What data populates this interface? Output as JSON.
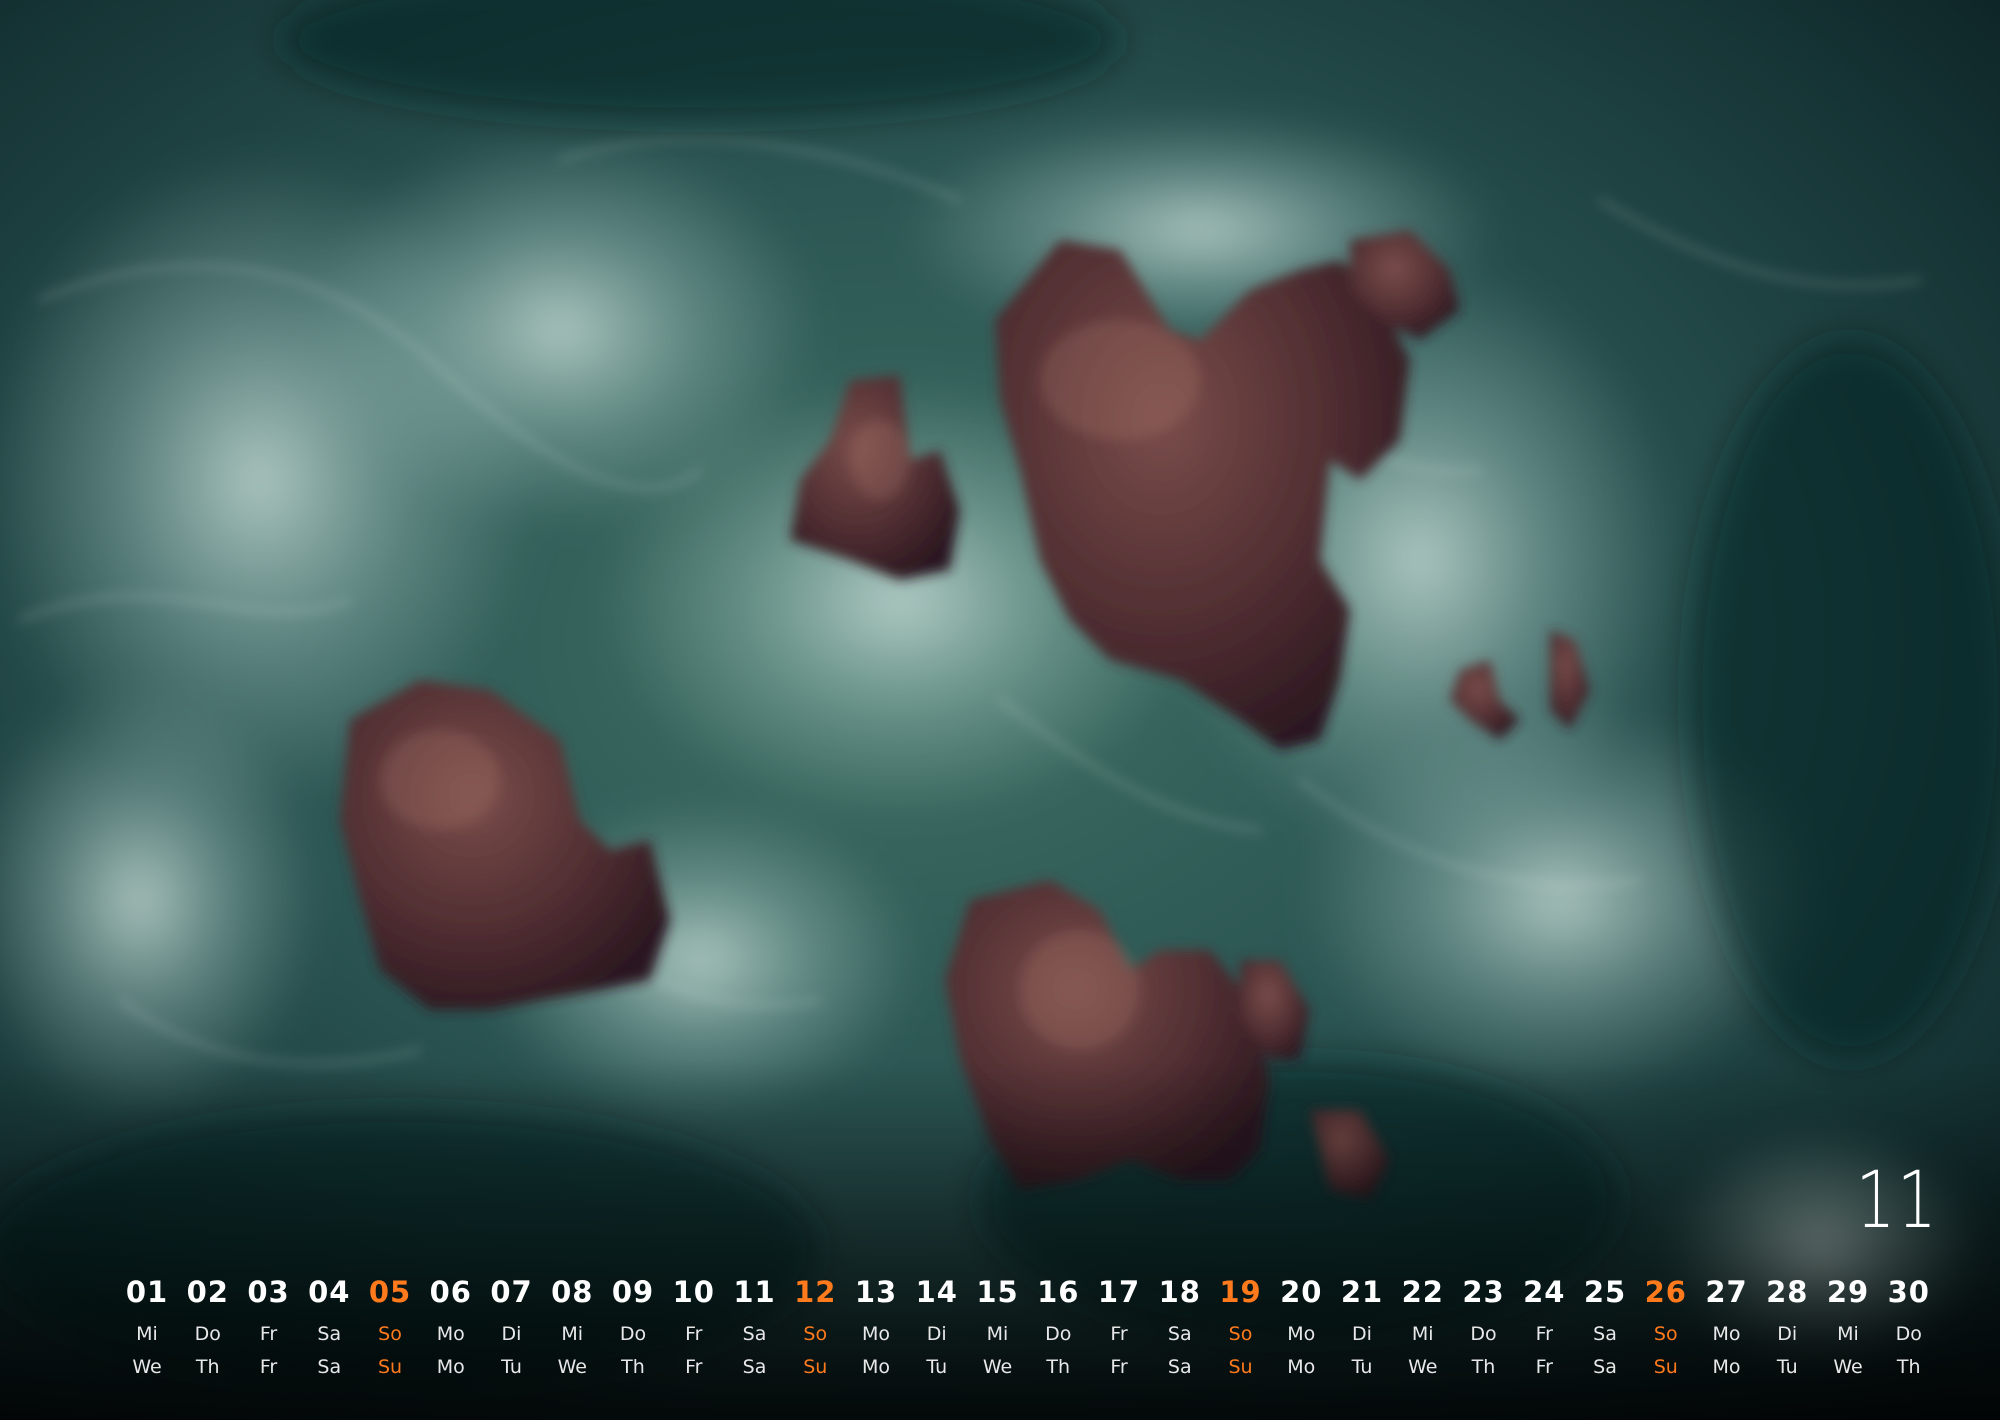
{
  "month": "11",
  "colors": {
    "sunday": "#ff7a1c",
    "text": "#ffffff"
  },
  "days": [
    {
      "num": "01",
      "de": "Mi",
      "en": "We",
      "sunday": false
    },
    {
      "num": "02",
      "de": "Do",
      "en": "Th",
      "sunday": false
    },
    {
      "num": "03",
      "de": "Fr",
      "en": "Fr",
      "sunday": false
    },
    {
      "num": "04",
      "de": "Sa",
      "en": "Sa",
      "sunday": false
    },
    {
      "num": "05",
      "de": "So",
      "en": "Su",
      "sunday": true
    },
    {
      "num": "06",
      "de": "Mo",
      "en": "Mo",
      "sunday": false
    },
    {
      "num": "07",
      "de": "Di",
      "en": "Tu",
      "sunday": false
    },
    {
      "num": "08",
      "de": "Mi",
      "en": "We",
      "sunday": false
    },
    {
      "num": "09",
      "de": "Do",
      "en": "Th",
      "sunday": false
    },
    {
      "num": "10",
      "de": "Fr",
      "en": "Fr",
      "sunday": false
    },
    {
      "num": "11",
      "de": "Sa",
      "en": "Sa",
      "sunday": false
    },
    {
      "num": "12",
      "de": "So",
      "en": "Su",
      "sunday": true
    },
    {
      "num": "13",
      "de": "Mo",
      "en": "Mo",
      "sunday": false
    },
    {
      "num": "14",
      "de": "Di",
      "en": "Tu",
      "sunday": false
    },
    {
      "num": "15",
      "de": "Mi",
      "en": "We",
      "sunday": false
    },
    {
      "num": "16",
      "de": "Do",
      "en": "Th",
      "sunday": false
    },
    {
      "num": "17",
      "de": "Fr",
      "en": "Fr",
      "sunday": false
    },
    {
      "num": "18",
      "de": "Sa",
      "en": "Sa",
      "sunday": false
    },
    {
      "num": "19",
      "de": "So",
      "en": "Su",
      "sunday": true
    },
    {
      "num": "20",
      "de": "Mo",
      "en": "Mo",
      "sunday": false
    },
    {
      "num": "21",
      "de": "Di",
      "en": "Tu",
      "sunday": false
    },
    {
      "num": "22",
      "de": "Mi",
      "en": "We",
      "sunday": false
    },
    {
      "num": "23",
      "de": "Do",
      "en": "Th",
      "sunday": false
    },
    {
      "num": "24",
      "de": "Fr",
      "en": "Fr",
      "sunday": false
    },
    {
      "num": "25",
      "de": "Sa",
      "en": "Sa",
      "sunday": false
    },
    {
      "num": "26",
      "de": "So",
      "en": "Su",
      "sunday": true
    },
    {
      "num": "27",
      "de": "Mo",
      "en": "Mo",
      "sunday": false
    },
    {
      "num": "28",
      "de": "Di",
      "en": "Tu",
      "sunday": false
    },
    {
      "num": "29",
      "de": "Mi",
      "en": "We",
      "sunday": false
    },
    {
      "num": "30",
      "de": "Do",
      "en": "Th",
      "sunday": false
    }
  ]
}
